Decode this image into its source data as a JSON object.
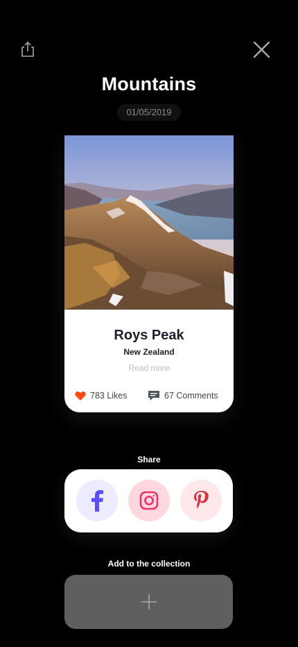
{
  "header": {
    "share_icon": "share-icon",
    "close_icon": "close-icon"
  },
  "album": {
    "title": "Mountains",
    "date": "01/05/2019"
  },
  "card": {
    "title": "Roys Peak",
    "subtitle": "New Zealand",
    "read_more": "Read more",
    "likes_label": "783 Likes",
    "comments_label": "67 Comments",
    "heart_color": "#ff4b12"
  },
  "share": {
    "label": "Share",
    "facebook_icon": "facebook-icon",
    "instagram_icon": "instagram-icon",
    "pinterest_icon": "pinterest-icon"
  },
  "collection": {
    "label": "Add to the collection",
    "add_icon": "plus-icon"
  }
}
